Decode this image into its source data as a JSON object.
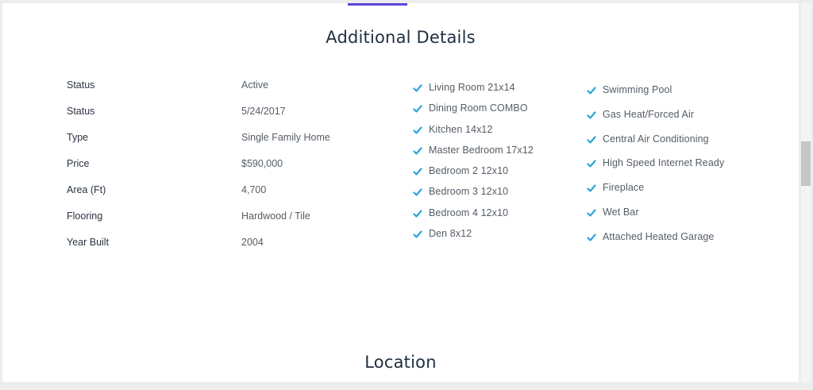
{
  "details": {
    "title": "Additional Details",
    "specs": [
      {
        "label": "Status",
        "value": "Active"
      },
      {
        "label": "Status",
        "value": "5/24/2017"
      },
      {
        "label": "Type",
        "value": "Single Family Home"
      },
      {
        "label": "Price",
        "value": "$590,000"
      },
      {
        "label": "Area (Ft)",
        "value": "4,700"
      },
      {
        "label": "Flooring",
        "value": "Hardwood / Tile"
      },
      {
        "label": "Year Built",
        "value": "2004"
      }
    ],
    "rooms": [
      "Living Room 21x14",
      "Dining Room COMBO",
      "Kitchen 14x12",
      "Master Bedroom 17x12",
      "Bedroom 2 12x10",
      "Bedroom 3 12x10",
      "Bedroom 4 12x10",
      "Den 8x12"
    ],
    "amenities": [
      "Swimming Pool",
      "Gas Heat/Forced Air",
      "Central Air Conditioning",
      "High Speed Internet Ready",
      "Fireplace",
      "Wet Bar",
      "Attached Heated Garage"
    ],
    "check_icon": "check-icon",
    "check_color": "#2aa3dc"
  },
  "location": {
    "title": "Location"
  },
  "colors": {
    "tab_indicator": "#5b45d6",
    "heading": "#1f2f40",
    "page_background": "#ededed"
  }
}
